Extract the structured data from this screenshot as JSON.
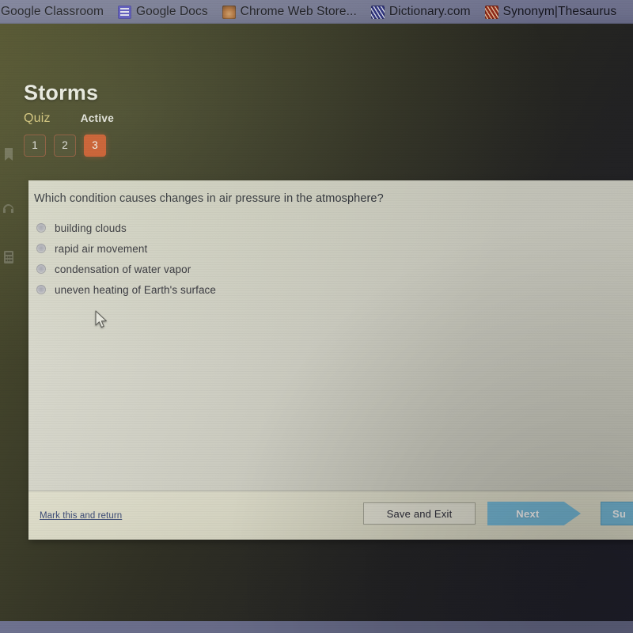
{
  "browser": {
    "bookmarks": [
      {
        "label": "Google Classroom",
        "icon": "google-classroom-icon"
      },
      {
        "label": "Google Docs",
        "icon": "google-docs-icon"
      },
      {
        "label": "Chrome Web Store...",
        "icon": "chrome-web-store-icon"
      },
      {
        "label": "Dictionary.com",
        "icon": "dictionary-icon"
      },
      {
        "label": "Synonym|Thesaurus",
        "icon": "thesaurus-icon"
      }
    ]
  },
  "rail": {
    "icons": [
      "bookmark-icon",
      "headphones-icon",
      "calculator-icon"
    ]
  },
  "quiz": {
    "title": "Storms",
    "tab_quiz": "Quiz",
    "tab_status": "Active",
    "question_numbers": [
      "1",
      "2",
      "3"
    ],
    "active_question": "3",
    "accent_color": "#d2562a",
    "question": "Which condition causes changes in air pressure in the atmosphere?",
    "options": [
      {
        "label": "building clouds",
        "selected": false
      },
      {
        "label": "rapid air movement",
        "selected": false
      },
      {
        "label": "condensation of water vapor",
        "selected": false
      },
      {
        "label": "uneven heating of Earth's surface",
        "selected": false
      }
    ]
  },
  "footer": {
    "mark_return": "Mark this and return",
    "save_exit": "Save and Exit",
    "next": "Next",
    "submit": "Su",
    "next_color": "#79bedd"
  }
}
